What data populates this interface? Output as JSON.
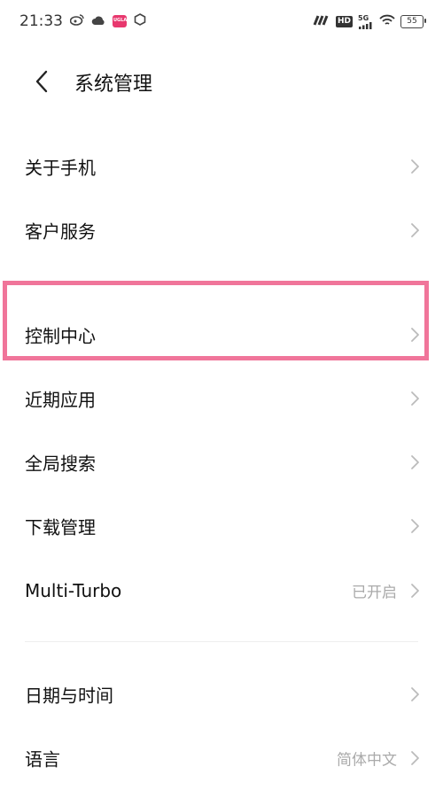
{
  "status_bar": {
    "time": "21:33",
    "hd": "HD",
    "network": "5G",
    "battery": "55",
    "app_badge": "UGLA"
  },
  "header": {
    "title": "系统管理"
  },
  "items": [
    {
      "label": "关于手机",
      "value": ""
    },
    {
      "label": "客户服务",
      "value": ""
    },
    {
      "label": "控制中心",
      "value": ""
    },
    {
      "label": "近期应用",
      "value": ""
    },
    {
      "label": "全局搜索",
      "value": ""
    },
    {
      "label": "下载管理",
      "value": ""
    },
    {
      "label": "Multi-Turbo",
      "value": "已开启"
    },
    {
      "label": "日期与时间",
      "value": ""
    },
    {
      "label": "语言",
      "value": "简体中文"
    }
  ],
  "colors": {
    "highlight": "#f0759a",
    "app_icon": "#e8386e"
  }
}
